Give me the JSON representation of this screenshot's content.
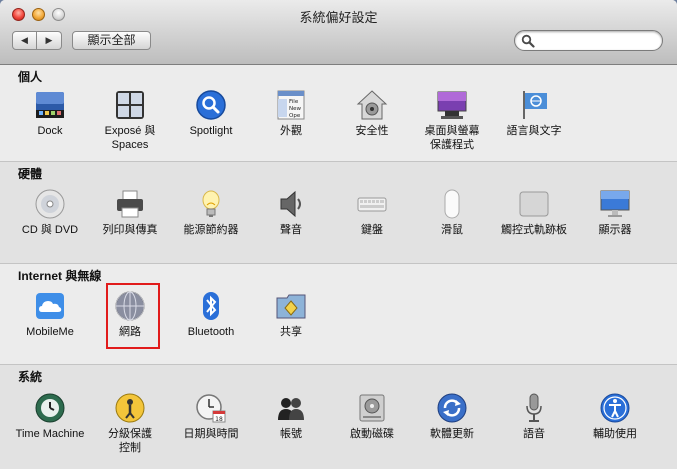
{
  "window": {
    "title": "系統偏好設定"
  },
  "toolbar": {
    "back_label": "◀",
    "forward_label": "▶",
    "show_all_label": "顯示全部"
  },
  "search": {
    "value": "",
    "placeholder": ""
  },
  "sections": [
    {
      "title": "個人",
      "items": [
        {
          "label": "Dock",
          "label2": ""
        },
        {
          "label": "Exposé 與",
          "label2": "Spaces"
        },
        {
          "label": "Spotlight",
          "label2": ""
        },
        {
          "label": "外觀",
          "label2": ""
        },
        {
          "label": "安全性",
          "label2": ""
        },
        {
          "label": "桌面與螢幕",
          "label2": "保護程式"
        },
        {
          "label": "語言與文字",
          "label2": ""
        }
      ]
    },
    {
      "title": "硬體",
      "items": [
        {
          "label": "CD 與 DVD",
          "label2": ""
        },
        {
          "label": "列印與傳真",
          "label2": ""
        },
        {
          "label": "能源節約器",
          "label2": ""
        },
        {
          "label": "聲音",
          "label2": ""
        },
        {
          "label": "鍵盤",
          "label2": ""
        },
        {
          "label": "滑鼠",
          "label2": ""
        },
        {
          "label": "觸控式軌跡板",
          "label2": ""
        },
        {
          "label": "顯示器",
          "label2": ""
        }
      ]
    },
    {
      "title": "Internet 與無線",
      "items": [
        {
          "label": "MobileMe",
          "label2": ""
        },
        {
          "label": "網路",
          "label2": ""
        },
        {
          "label": "Bluetooth",
          "label2": ""
        },
        {
          "label": "共享",
          "label2": ""
        }
      ]
    },
    {
      "title": "系統",
      "items": [
        {
          "label": "Time Machine",
          "label2": ""
        },
        {
          "label": "分級保護",
          "label2": "控制"
        },
        {
          "label": "日期與時間",
          "label2": ""
        },
        {
          "label": "帳號",
          "label2": ""
        },
        {
          "label": "啟動磁碟",
          "label2": ""
        },
        {
          "label": "軟體更新",
          "label2": ""
        },
        {
          "label": "語音",
          "label2": ""
        },
        {
          "label": "輔助使用",
          "label2": ""
        }
      ]
    }
  ],
  "icon_text": {
    "appearance_file": "File",
    "appearance_new": "New",
    "appearance_open": "Ope",
    "calendar_day": "18"
  },
  "colors": {
    "highlight": "#e11b1b",
    "accent_blue": "#2a6fd8"
  }
}
